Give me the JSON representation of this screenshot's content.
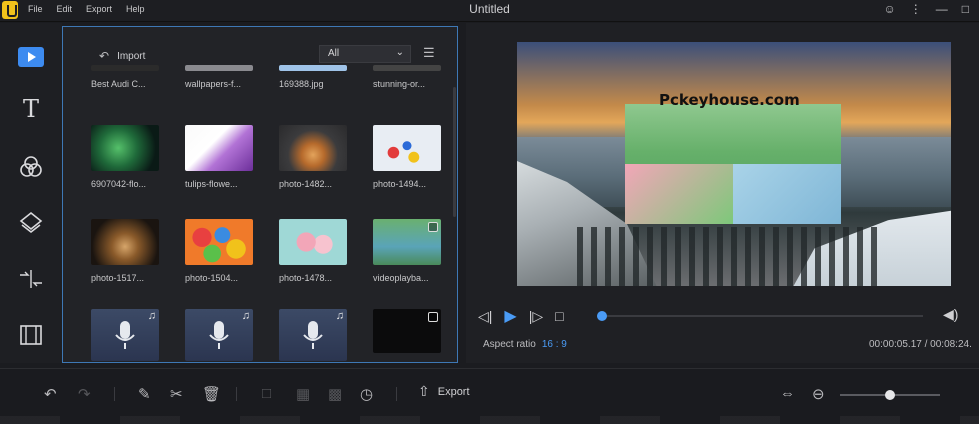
{
  "app": {
    "title": "Untitled"
  },
  "menu": {
    "file": "File",
    "edit": "Edit",
    "export": "Export",
    "help": "Help"
  },
  "media": {
    "import_label": "Import",
    "filter_value": "All",
    "rows": [
      [
        "Best Audi C...",
        "wallpapers-f...",
        "169388.jpg",
        "stunning-or..."
      ],
      [
        "6907042-flo...",
        "tulips-flowe...",
        "photo-1482...",
        "photo-1494..."
      ],
      [
        "photo-1517...",
        "photo-1504...",
        "photo-1478...",
        "videoplayba..."
      ]
    ]
  },
  "preview": {
    "watermark": "Pckeyhouse.com",
    "aspect_label": "Aspect ratio",
    "aspect_value": "16 : 9",
    "timecode": "00:00:05.17 / 00:08:24.",
    "progress_fraction": 0.0
  },
  "toolbar": {
    "export_label": "Export",
    "zoom_fraction": 0.5
  },
  "colors": {
    "accent": "#4a9bf5",
    "panel_border": "#3e78b5"
  }
}
